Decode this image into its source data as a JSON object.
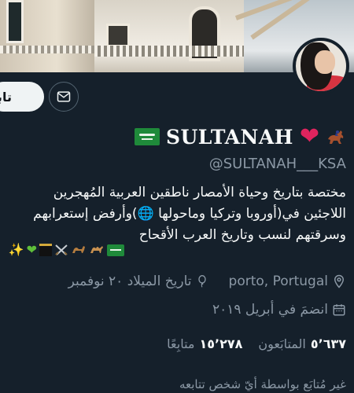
{
  "profile": {
    "display_name": "SULTANAH",
    "handle": "@SULTANAH___KSA",
    "bio_lines": [
      "مختصة بتاريخ وحياة الأمصار ناطقين العربية المُهجرين",
      "اللاجئين في(أوروبا وتركيا وماحولها 🌐)وأرفض إستعرابهم",
      "وسرقتهم لنسب وتاريخ العرب الأقحاح"
    ],
    "location": "porto, Portugal",
    "birthday": "تاريخ الميلاد ٢٠ نوفمبر",
    "joined": "انضمَ في أبريل ٢٠١٩",
    "following_count": "٥٬٦٣٧",
    "following_label": "المتابَعون",
    "followers_count": "١٥٬٢٧٨",
    "followers_label": "متابِعًا",
    "not_followed_text": "غير مُتابَع بواسطة أيّ شخص تتابعه"
  },
  "actions": {
    "follow_label": "تابع"
  },
  "icons": {
    "flag": "saudi-flag-icon",
    "heart": "red-heart-icon",
    "horse": "horse-racing-icon",
    "message": "envelope-icon",
    "location": "location-pin-icon",
    "calendar": "calendar-icon",
    "birthday": "balloon-icon"
  },
  "colors": {
    "background": "#15202b",
    "text_primary": "#f7f9f9",
    "text_secondary": "#8b98a5",
    "follow_button_bg": "#eff3f4",
    "heart": "#e0245e"
  }
}
